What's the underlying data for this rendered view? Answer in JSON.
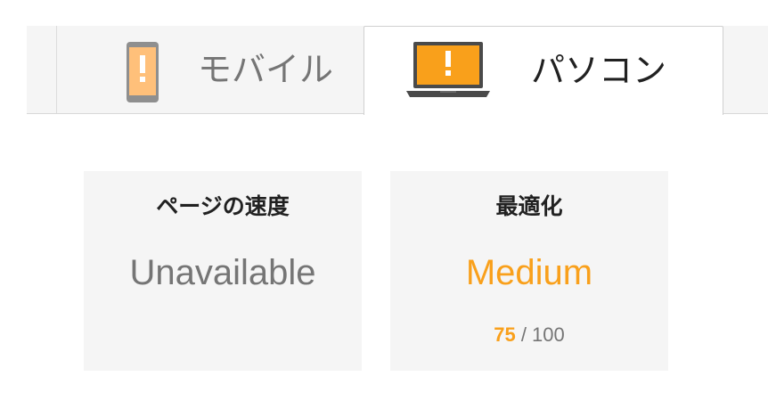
{
  "tabs": {
    "mobile": {
      "label": "モバイル",
      "icon": "mobile-warning-icon"
    },
    "desktop": {
      "label": "パソコン",
      "icon": "laptop-warning-icon",
      "selected": true
    }
  },
  "cards": {
    "speed": {
      "title": "ページの速度",
      "value": "Unavailable"
    },
    "optimization": {
      "title": "最適化",
      "value": "Medium",
      "score": "75",
      "score_max": "/ 100"
    }
  },
  "colors": {
    "warning_orange": "#f9a01b",
    "mobile_icon_orange": "#ffc07a",
    "device_gray": "#8a8a8a",
    "laptop_dark": "#4a4a4a",
    "card_bg": "#f5f5f5"
  }
}
